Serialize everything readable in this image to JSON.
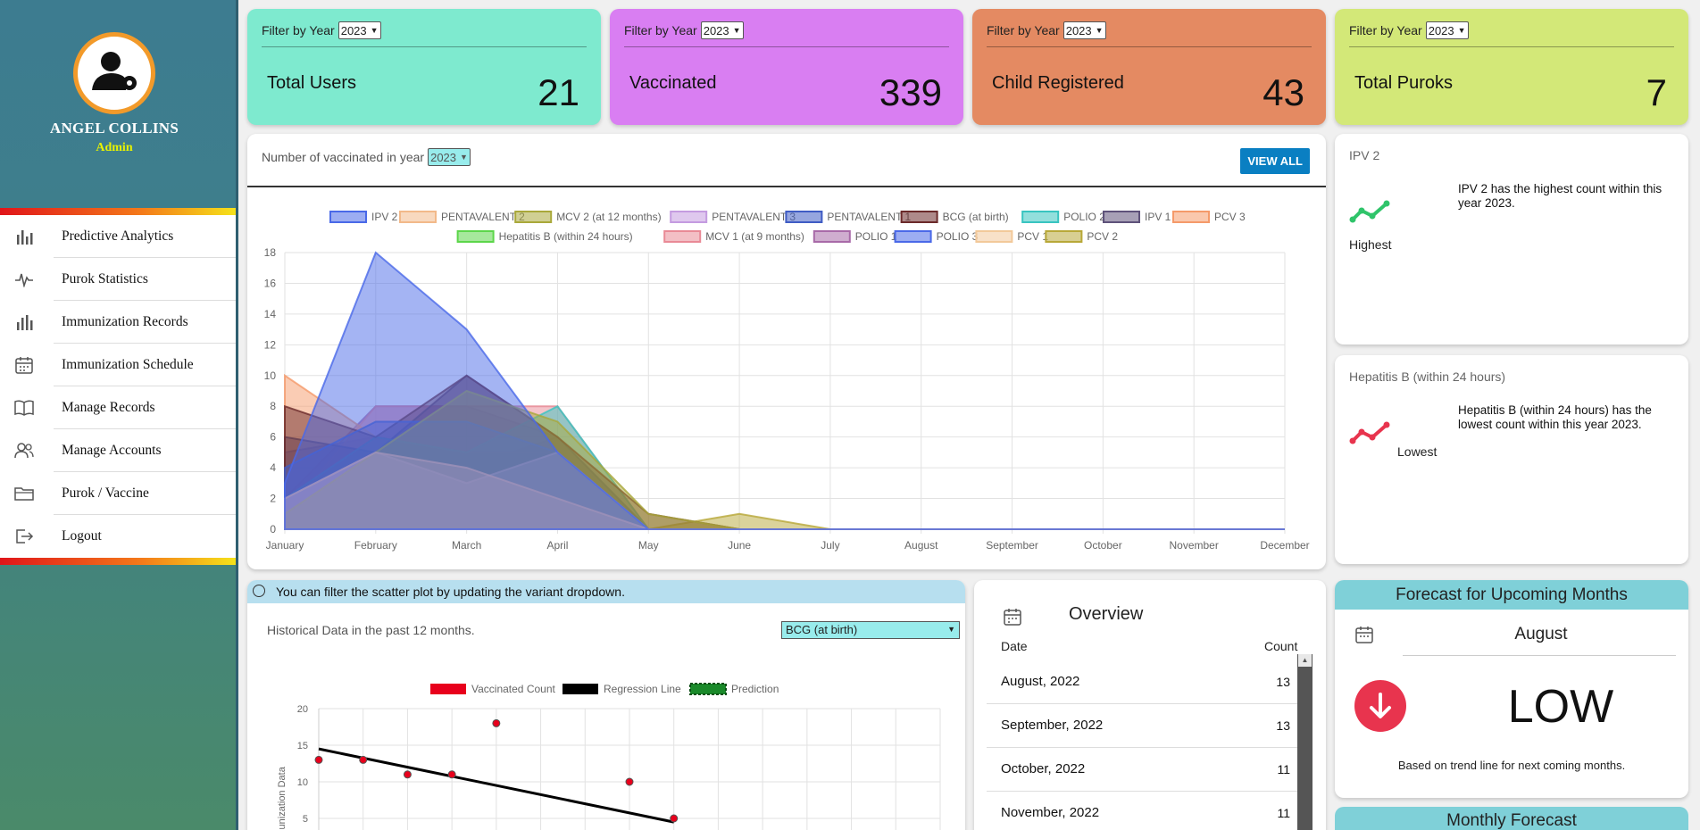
{
  "sidebar": {
    "user_name": "ANGEL COLLINS",
    "user_role": "Admin",
    "items": [
      {
        "label": "Predictive Analytics",
        "icon": "bar-chart-icon"
      },
      {
        "label": "Purok Statistics",
        "icon": "pulse-icon"
      },
      {
        "label": "Immunization Records",
        "icon": "bar-chart-icon"
      },
      {
        "label": "Immunization Schedule",
        "icon": "calendar-icon"
      },
      {
        "label": "Manage Records",
        "icon": "book-icon"
      },
      {
        "label": "Manage Accounts",
        "icon": "users-icon"
      },
      {
        "label": "Purok / Vaccine",
        "icon": "folder-icon"
      },
      {
        "label": "Logout",
        "icon": "logout-icon"
      }
    ]
  },
  "stats": [
    {
      "filter_label": "Filter by Year",
      "year": "2023",
      "label": "Total Users",
      "value": "21",
      "color": "#7eeacf"
    },
    {
      "filter_label": "Filter by Year",
      "year": "2023",
      "label": "Vaccinated",
      "value": "339",
      "color": "#d97ef2"
    },
    {
      "filter_label": "Filter by Year",
      "year": "2023",
      "label": "Child Registered",
      "value": "43",
      "color": "#e48a62"
    },
    {
      "filter_label": "Filter by Year",
      "year": "2023",
      "label": "Total Puroks",
      "value": "7",
      "color": "#d3e878"
    }
  ],
  "vacc_chart": {
    "title": "Number of vaccinated in year",
    "year": "2023",
    "view_all": "VIEW ALL"
  },
  "highest": {
    "title": "IPV 2",
    "description": "IPV 2 has the highest count within this year 2023.",
    "tag": "Highest",
    "color": "#2fc46a"
  },
  "lowest": {
    "title": "Hepatitis B (within 24 hours)",
    "description": "Hepatitis B (within 24 hours) has the lowest count within this year 2023.",
    "tag": "Lowest",
    "color": "#e8344e"
  },
  "scatter": {
    "tip": "You can filter the scatter plot by updating the variant dropdown.",
    "subtitle": "Historical Data in the past 12 months.",
    "variant": "BCG (at birth)"
  },
  "overview": {
    "title": "Overview",
    "col_date": "Date",
    "col_count": "Count",
    "rows": [
      {
        "date": "August, 2022",
        "count": "13"
      },
      {
        "date": "September, 2022",
        "count": "13"
      },
      {
        "date": "October, 2022",
        "count": "11"
      },
      {
        "date": "November, 2022",
        "count": "11"
      }
    ]
  },
  "forecast": {
    "title": "Forecast for Upcoming Months",
    "month": "August",
    "level": "LOW",
    "note": "Based on trend line for next coming months.",
    "monthly_title": "Monthly Forecast"
  },
  "chart_data": [
    {
      "type": "area",
      "x": [
        "January",
        "February",
        "March",
        "April",
        "May",
        "June",
        "July",
        "August",
        "September",
        "October",
        "November",
        "December"
      ],
      "ylim": [
        0,
        18
      ],
      "yticks": [
        0,
        2,
        4,
        6,
        8,
        10,
        12,
        14,
        16,
        18
      ],
      "grid": true,
      "legend_position": "top",
      "series": [
        {
          "name": "IPV 2",
          "color": "#4a69e8",
          "values": [
            3,
            18,
            13,
            5,
            0,
            0,
            0,
            0,
            0,
            0,
            0,
            0
          ]
        },
        {
          "name": "PENTAVALENT 2",
          "color": "#f2b98a",
          "values": [
            2,
            5,
            4,
            2,
            0,
            0,
            0,
            0,
            0,
            0,
            0,
            0
          ]
        },
        {
          "name": "MCV 2 (at 12 months)",
          "color": "#a9a83a",
          "values": [
            1,
            5,
            9,
            7,
            1,
            0,
            0,
            0,
            0,
            0,
            0,
            0
          ]
        },
        {
          "name": "PENTAVALENT 3",
          "color": "#c49be0",
          "values": [
            2,
            5,
            3,
            5,
            0,
            0,
            0,
            0,
            0,
            0,
            0,
            0
          ]
        },
        {
          "name": "PENTAVALENT 1",
          "color": "#3f5cc4",
          "values": [
            4,
            7,
            7,
            5,
            0,
            0,
            0,
            0,
            0,
            0,
            0,
            0
          ]
        },
        {
          "name": "BCG (at birth)",
          "color": "#6b2a2a",
          "values": [
            8,
            6,
            10,
            6,
            1,
            0,
            0,
            0,
            0,
            0,
            0,
            0
          ]
        },
        {
          "name": "POLIO 2",
          "color": "#38c4c0",
          "values": [
            2,
            6,
            5,
            8,
            0,
            0,
            0,
            0,
            0,
            0,
            0,
            0
          ]
        },
        {
          "name": "IPV 1",
          "color": "#5e527a",
          "values": [
            6,
            5,
            10,
            6,
            0,
            0,
            0,
            0,
            0,
            0,
            0,
            0
          ]
        },
        {
          "name": "PCV 3",
          "color": "#f59a6a",
          "values": [
            10,
            6,
            5,
            5,
            0,
            0,
            0,
            0,
            0,
            0,
            0,
            0
          ]
        },
        {
          "name": "Hepatitis B (within 24 hours)",
          "color": "#5cd64a",
          "values": [
            0,
            0,
            0,
            0,
            0,
            0,
            0,
            0,
            0,
            0,
            0,
            0
          ]
        },
        {
          "name": "MCV 1 (at 9 months)",
          "color": "#e98a96",
          "values": [
            1,
            8,
            8,
            8,
            0,
            0,
            0,
            0,
            0,
            0,
            0,
            0
          ]
        },
        {
          "name": "POLIO 1",
          "color": "#a86aa8",
          "values": [
            2,
            8,
            8,
            6,
            0,
            0,
            0,
            0,
            0,
            0,
            0,
            0
          ]
        },
        {
          "name": "POLIO 3",
          "color": "#4a69e8",
          "values": [
            5,
            6,
            5,
            5,
            0,
            0,
            0,
            0,
            0,
            0,
            0,
            0
          ]
        },
        {
          "name": "PCV 1",
          "color": "#f2c99a",
          "values": [
            1,
            4,
            4,
            3,
            0,
            0,
            0,
            0,
            0,
            0,
            0,
            0
          ]
        },
        {
          "name": "PCV 2",
          "color": "#b8a838",
          "values": [
            1,
            3,
            4,
            6,
            0,
            1,
            0,
            0,
            0,
            0,
            0,
            0
          ]
        }
      ]
    },
    {
      "type": "scatter",
      "ylabel": "Immunization Data",
      "ylim": [
        0,
        20
      ],
      "yticks": [
        5,
        10,
        15,
        20
      ],
      "grid": true,
      "legend_position": "top",
      "series": [
        {
          "name": "Vaccinated Count",
          "color": "#e8001c",
          "x": [
            1,
            2,
            3,
            4,
            5,
            8,
            9
          ],
          "y": [
            13,
            13,
            11,
            11,
            18,
            10,
            5
          ]
        },
        {
          "name": "Regression Line",
          "color": "#000000",
          "x": [
            1,
            9
          ],
          "y": [
            14.5,
            4.5
          ]
        },
        {
          "name": "Prediction",
          "color": "#1a8a2a",
          "x": [],
          "y": []
        }
      ],
      "xlim": [
        1,
        15
      ]
    }
  ]
}
